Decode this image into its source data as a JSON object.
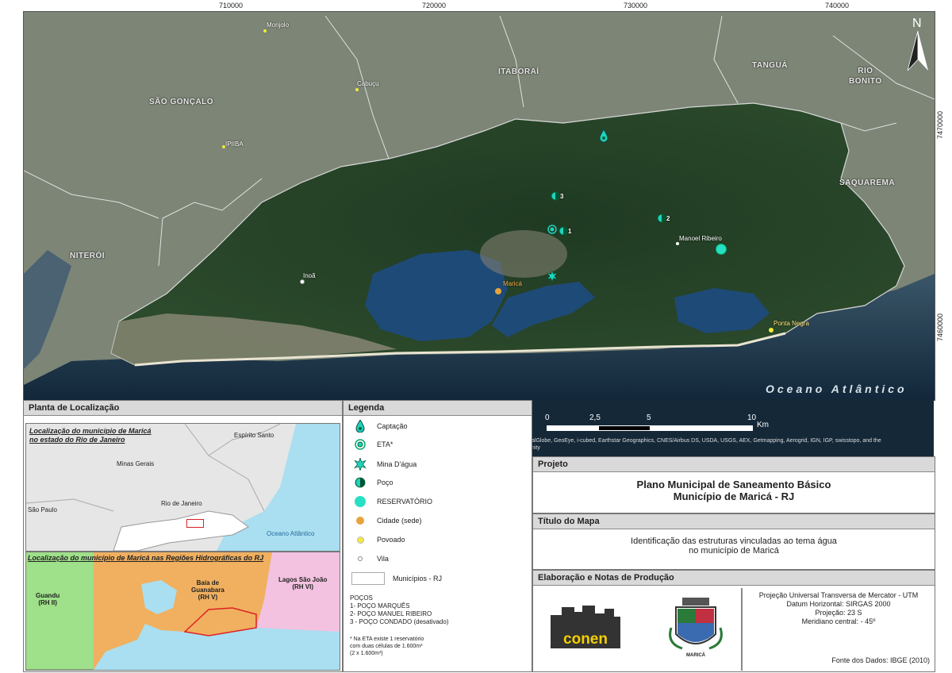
{
  "coords": {
    "top": [
      "710000",
      "720000",
      "730000",
      "740000"
    ],
    "right": [
      "7470000",
      "7460000"
    ]
  },
  "map": {
    "places": {
      "sao_goncalo": "SÃO GONÇALO",
      "itaborai": "ITABORAÍ",
      "tangua": "TANGUÁ",
      "rio_bonito": "RIO\nBONITO",
      "niteroi": "NITERÓI",
      "saquarema": "SAQUAREMA"
    },
    "villages": {
      "monjolo": "Monjolo",
      "cabucu": "Cabuçu",
      "ipiiba": "IPIIBA",
      "inoa": "Inoã",
      "manoel_ribeiro": "Manoel Ribeiro",
      "ponta_negra": "Ponta Negra",
      "marica": "Maricá"
    },
    "well_numbers": [
      "1",
      "2",
      "3"
    ],
    "ocean_label": "Oceano Atlântico",
    "north_label": "N",
    "scale": {
      "ticks": [
        "0",
        "2,5",
        "5",
        "10"
      ],
      "unit": "Km"
    },
    "attribution": "alGlobe, GeoEye, i-cubed, Earthstar Geographics, CNES/Airbus DS, USDA, USGS, AEX, Getmapping, Aerogrid, IGN, IGP, swisstopo, and the\nnity"
  },
  "location": {
    "title": "Planta de Localização",
    "inset1": {
      "title": "Localização do município de Maricá\nno estado do Rio de Janeiro",
      "labels": [
        "Espírito Santo",
        "Minas Gerais",
        "São Paulo",
        "Rio de Janeiro",
        "Oceano Atlântico"
      ]
    },
    "inset2": {
      "title": "Localização do município de Maricá nas Regiões Hidrográficas do  RJ",
      "labels": [
        "Guandu\n(RH II)",
        "Baía de\nGuanabara\n(RH V)",
        "Lagos São João\n(RH VI)"
      ]
    }
  },
  "legend": {
    "title": "Legenda",
    "items": [
      "Captação",
      "ETA*",
      "Mina D'água",
      "Poço",
      "RESERVATÓRIO",
      "Cidade (sede)",
      "Povoado",
      "Vila",
      "Municípios - RJ"
    ],
    "wells_title": "POÇOS",
    "wells": [
      "1- POÇO MARQUÊS",
      "2- POÇO MANUEL RIBEIRO",
      "3 - POÇO CONDADO (desativado)"
    ],
    "note": "* Na ETA existe 1 reservatório\ncom duas células de 1.600m³\n(2 x 1.600m³)"
  },
  "projeto": {
    "header": "Projeto",
    "line1": "Plano Municipal de Saneamento Básico",
    "line2": "Município de Maricá - RJ"
  },
  "titulo": {
    "header": "Título do Mapa",
    "line1": "Identificação das estruturas vinculadas ao tema água",
    "line2": "no município de Maricá"
  },
  "elaboracao": {
    "header": "Elaboração e Notas de Produção",
    "logo_text": "conen",
    "crest_text": "MARICÁ",
    "notes": [
      "Projeção Universal Transversa de Mercator - UTM",
      "Datum Horizontal: SIRGAS 2000",
      "Projeção: 23 S",
      "Meridiano central: - 45º"
    ],
    "source": "Fonte dos Dados: IBGE (2010)"
  },
  "colors": {
    "captacao": "#1fd3c0",
    "reservatorio": "#27e0c4",
    "cidade": "#e8a33a",
    "povoado": "#f2ea3a",
    "guanabara": "#f0b060",
    "guandu": "#9fe08a",
    "lagos": "#f2c2e0",
    "sea": "#a9dff0"
  }
}
